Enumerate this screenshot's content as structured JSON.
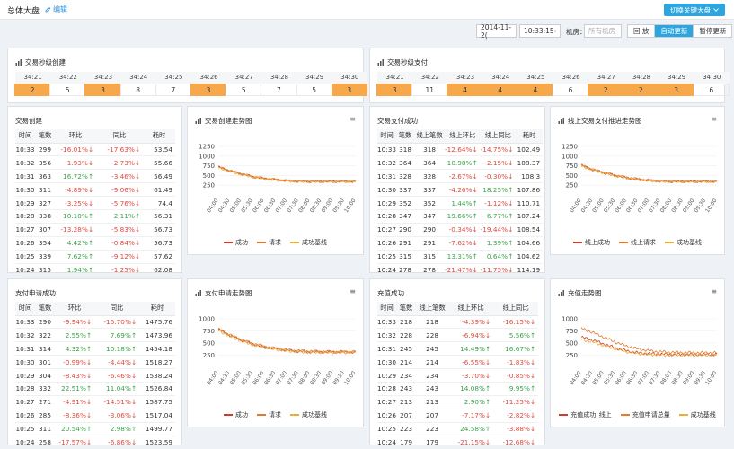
{
  "header": {
    "title": "总体大盘",
    "edit": "编辑",
    "switch_btn": "切换关键大盘"
  },
  "controls": {
    "date": "2014-11-2(",
    "time": "10:33:15",
    "room_label": "机房：",
    "room_placeholder": "所有机房",
    "modes": [
      "回 放",
      "自动更新",
      "暂停更新"
    ],
    "active_mode": 1
  },
  "colors": {
    "highlight": "#f6a84a",
    "up": "#3aa24a",
    "down": "#e0483c",
    "series1": "#cc3d2a",
    "series2": "#e07a2e",
    "series3": "#e8b035",
    "accent": "#2da6e0"
  },
  "tick_panels": [
    {
      "title": "交易秒级创建",
      "times": [
        "34:21",
        "34:22",
        "34:23",
        "34:24",
        "34:25",
        "34:26",
        "34:27",
        "34:28",
        "34:29",
        "34:30"
      ],
      "values": [
        "2",
        "5",
        "3",
        "8",
        "7",
        "3",
        "5",
        "7",
        "5",
        "3"
      ],
      "highlight": [
        true,
        false,
        true,
        false,
        false,
        true,
        false,
        false,
        false,
        true
      ]
    },
    {
      "title": "交易秒级支付",
      "times": [
        "34:21",
        "34:22",
        "34:23",
        "34:24",
        "34:25",
        "34:26",
        "34:27",
        "34:28",
        "34:29",
        "34:30"
      ],
      "values": [
        "3",
        "11",
        "4",
        "4",
        "4",
        "6",
        "2",
        "2",
        "3",
        "6"
      ],
      "highlight": [
        true,
        false,
        true,
        true,
        true,
        false,
        true,
        true,
        true,
        false
      ]
    }
  ],
  "tables": [
    {
      "title": "交易创建",
      "headers": [
        "时间",
        "笔数",
        "环比",
        "同比",
        "耗时"
      ],
      "rows": [
        [
          "10:33",
          "299",
          "-16.01%↓",
          "-17.63%↓",
          "53.54"
        ],
        [
          "10:32",
          "356",
          "-1.93%↓",
          "-2.73%↓",
          "55.66"
        ],
        [
          "10:31",
          "363",
          "16.72%↑",
          "-3.46%↓",
          "56.49"
        ],
        [
          "10:30",
          "311",
          "-4.89%↓",
          "-9.06%↓",
          "61.49"
        ],
        [
          "10:29",
          "327",
          "-3.25%↓",
          "-5.76%↓",
          "74.4"
        ],
        [
          "10:28",
          "338",
          "10.10%↑",
          "2.11%↑",
          "56.31"
        ],
        [
          "10:27",
          "307",
          "-13.28%↓",
          "-5.83%↓",
          "56.73"
        ],
        [
          "10:26",
          "354",
          "4.42%↑",
          "-0.84%↓",
          "56.73"
        ],
        [
          "10:25",
          "339",
          "7.62%↑",
          "-9.12%↓",
          "57.62"
        ],
        [
          "10:24",
          "315",
          "1.94%↑",
          "-1.25%↓",
          "62.08"
        ]
      ]
    },
    {
      "title": "交易支付成功",
      "headers": [
        "时间",
        "笔数",
        "线上笔数",
        "线上环比",
        "线上同比",
        "耗时"
      ],
      "rows": [
        [
          "10:33",
          "318",
          "318",
          "-12.64%↓",
          "-14.75%↓",
          "102.49"
        ],
        [
          "10:32",
          "364",
          "364",
          "10.98%↑",
          "-2.15%↓",
          "108.37"
        ],
        [
          "10:31",
          "328",
          "328",
          "-2.67%↓",
          "-0.30%↓",
          "108.3"
        ],
        [
          "10:30",
          "337",
          "337",
          "-4.26%↓",
          "18.25%↑",
          "107.86"
        ],
        [
          "10:29",
          "352",
          "352",
          "1.44%↑",
          "-1.12%↓",
          "110.71"
        ],
        [
          "10:28",
          "347",
          "347",
          "19.66%↑",
          "6.77%↑",
          "107.24"
        ],
        [
          "10:27",
          "290",
          "290",
          "-0.34%↓",
          "-19.44%↓",
          "108.54"
        ],
        [
          "10:26",
          "291",
          "291",
          "-7.62%↓",
          "1.39%↑",
          "104.66"
        ],
        [
          "10:25",
          "315",
          "315",
          "13.31%↑",
          "0.64%↑",
          "104.62"
        ],
        [
          "10:24",
          "278",
          "278",
          "-21.47%↓",
          "-11.75%↓",
          "114.19"
        ]
      ]
    },
    {
      "title": "支付申请成功",
      "headers": [
        "时间",
        "笔数",
        "环比",
        "同比",
        "耗时"
      ],
      "rows": [
        [
          "10:33",
          "290",
          "-9.94%↓",
          "-15.70%↓",
          "1475.76"
        ],
        [
          "10:32",
          "322",
          "2.55%↑",
          "7.69%↑",
          "1473.96"
        ],
        [
          "10:31",
          "314",
          "4.32%↑",
          "10.18%↑",
          "1454.18"
        ],
        [
          "10:30",
          "301",
          "-0.99%↓",
          "-4.44%↓",
          "1518.27"
        ],
        [
          "10:29",
          "304",
          "-8.43%↓",
          "-6.46%↓",
          "1538.24"
        ],
        [
          "10:28",
          "332",
          "22.51%↑",
          "11.04%↑",
          "1526.84"
        ],
        [
          "10:27",
          "271",
          "-4.91%↓",
          "-14.51%↓",
          "1587.75"
        ],
        [
          "10:26",
          "285",
          "-8.36%↓",
          "-3.06%↓",
          "1517.04"
        ],
        [
          "10:25",
          "311",
          "20.54%↑",
          "2.98%↑",
          "1499.77"
        ],
        [
          "10:24",
          "258",
          "-17.57%↓",
          "-6.86%↓",
          "1523.59"
        ]
      ]
    },
    {
      "title": "充值成功",
      "headers": [
        "时间",
        "笔数",
        "线上笔数",
        "线上环比",
        "线上同比"
      ],
      "rows": [
        [
          "10:33",
          "218",
          "218",
          "-4.39%↓",
          "-16.15%↓"
        ],
        [
          "10:32",
          "228",
          "228",
          "-6.94%↓",
          "5.56%↑"
        ],
        [
          "10:31",
          "245",
          "245",
          "14.49%↑",
          "16.67%↑"
        ],
        [
          "10:30",
          "214",
          "214",
          "-6.55%↓",
          "-1.83%↓"
        ],
        [
          "10:29",
          "234",
          "234",
          "-3.70%↓",
          "-0.85%↓"
        ],
        [
          "10:28",
          "243",
          "243",
          "14.08%↑",
          "9.95%↑"
        ],
        [
          "10:27",
          "213",
          "213",
          "2.90%↑",
          "-11.25%↓"
        ],
        [
          "10:26",
          "207",
          "207",
          "-7.17%↓",
          "-2.82%↓"
        ],
        [
          "10:25",
          "223",
          "223",
          "24.58%↑",
          "-3.88%↓"
        ],
        [
          "10:24",
          "179",
          "179",
          "-21.15%↓",
          "-12.68%↓"
        ]
      ]
    }
  ],
  "chart_data": [
    {
      "type": "line",
      "title": "交易创建走势图",
      "ylim": [
        0,
        1250
      ],
      "yticks": [
        "1250",
        "1000",
        "750",
        "500",
        "250"
      ],
      "x_start": "04:00",
      "x_step_min": 30,
      "x_count": 13,
      "series": [
        {
          "name": "成功",
          "values": [
            720,
            620,
            540,
            470,
            420,
            390,
            365,
            350,
            345,
            345,
            345,
            345,
            345
          ]
        },
        {
          "name": "请求",
          "values": [
            725,
            625,
            545,
            475,
            425,
            395,
            370,
            355,
            350,
            350,
            350,
            350,
            350
          ]
        },
        {
          "name": "成功基线",
          "values": [
            700,
            600,
            525,
            460,
            410,
            380,
            358,
            345,
            340,
            340,
            340,
            340,
            340
          ]
        }
      ]
    },
    {
      "type": "line",
      "title": "线上交易支付推进走势图",
      "ylim": [
        0,
        1250
      ],
      "yticks": [
        "1250",
        "1000",
        "750",
        "500",
        "250"
      ],
      "x_start": "04:00",
      "x_step_min": 30,
      "x_count": 13,
      "series": [
        {
          "name": "线上成功",
          "values": [
            760,
            650,
            570,
            500,
            440,
            400,
            370,
            350,
            345,
            345,
            345,
            345,
            345
          ]
        },
        {
          "name": "线上请求",
          "values": [
            770,
            660,
            580,
            510,
            450,
            410,
            380,
            360,
            350,
            350,
            350,
            350,
            350
          ]
        },
        {
          "name": "成功基线",
          "values": [
            740,
            640,
            560,
            490,
            430,
            390,
            360,
            345,
            340,
            340,
            340,
            340,
            340
          ]
        }
      ]
    },
    {
      "type": "line",
      "title": "支付申请走势图",
      "ylim": [
        0,
        1000
      ],
      "yticks": [
        "1000",
        "750",
        "500",
        "250"
      ],
      "x_start": "04:00",
      "x_step_min": 30,
      "x_count": 13,
      "series": [
        {
          "name": "成功",
          "values": [
            780,
            660,
            560,
            480,
            420,
            380,
            350,
            330,
            320,
            318,
            315,
            315,
            315
          ]
        },
        {
          "name": "请求",
          "values": [
            790,
            670,
            570,
            490,
            430,
            390,
            360,
            340,
            330,
            325,
            320,
            320,
            320
          ]
        },
        {
          "name": "成功基线",
          "values": [
            760,
            640,
            545,
            465,
            410,
            370,
            340,
            320,
            310,
            308,
            305,
            305,
            305
          ]
        }
      ]
    },
    {
      "type": "line",
      "title": "充值走势图",
      "ylim": [
        0,
        1000
      ],
      "yticks": [
        "1000",
        "750",
        "500",
        "250"
      ],
      "x_start": "04:00",
      "x_step_min": 30,
      "x_count": 13,
      "series": [
        {
          "name": "充值成功_线上",
          "values": [
            620,
            560,
            480,
            400,
            340,
            300,
            280,
            270,
            265,
            265,
            265,
            265,
            265
          ]
        },
        {
          "name": "充值申请总量",
          "values": [
            800,
            720,
            620,
            520,
            440,
            380,
            340,
            320,
            310,
            305,
            300,
            300,
            300
          ]
        },
        {
          "name": "成功基线",
          "values": [
            580,
            520,
            450,
            380,
            320,
            285,
            265,
            255,
            250,
            250,
            250,
            250,
            250
          ]
        }
      ]
    }
  ]
}
